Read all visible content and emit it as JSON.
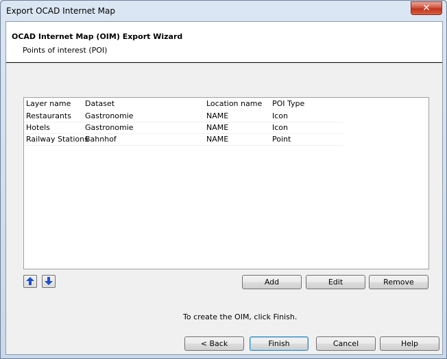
{
  "window": {
    "title": "Export OCAD Internet Map",
    "close_glyph": "✕"
  },
  "header": {
    "title": "OCAD Internet Map (OIM) Export Wizard",
    "subtitle": "Points of interest (POI)"
  },
  "list": {
    "columns": [
      "Layer name",
      "Dataset",
      "Location name",
      "POI Type"
    ],
    "rows": [
      [
        "Restaurants",
        "Gastronomie",
        "NAME",
        "Icon"
      ],
      [
        "Hotels",
        "Gastronomie",
        "NAME",
        "Icon"
      ],
      [
        "Railway Stations",
        "Bahnhof",
        "NAME",
        "Point"
      ]
    ]
  },
  "buttons": {
    "move_up_icon": "arrow-up-icon",
    "move_down_icon": "arrow-down-icon",
    "add": "Add",
    "edit": "Edit",
    "remove": "Remove",
    "back": "< Back",
    "finish": "Finish",
    "cancel": "Cancel",
    "help": "Help"
  },
  "hint": "To create the OIM, click Finish.",
  "colors": {
    "arrow_blue": "#1f4fd1",
    "accent_border": "#3c7fb1"
  }
}
